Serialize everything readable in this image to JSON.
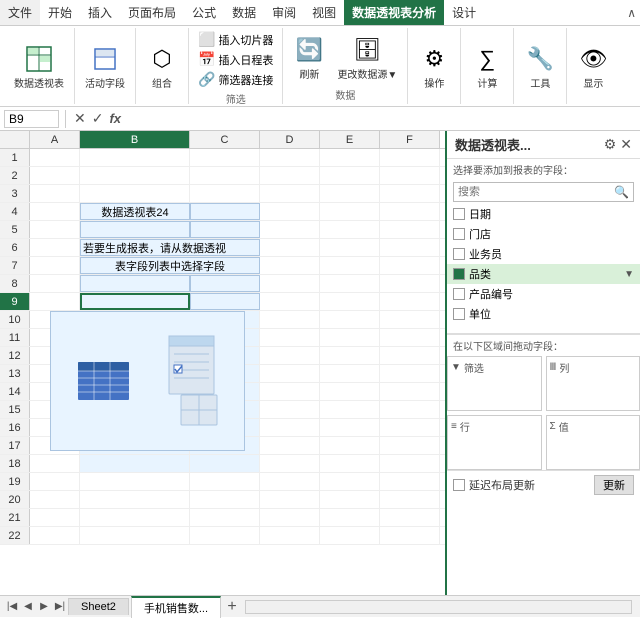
{
  "ribbon": {
    "tabs": [
      {
        "label": "文件",
        "active": false
      },
      {
        "label": "开始",
        "active": false
      },
      {
        "label": "插入",
        "active": false
      },
      {
        "label": "页面布局",
        "active": false
      },
      {
        "label": "公式",
        "active": false
      },
      {
        "label": "数据",
        "active": false
      },
      {
        "label": "审阅",
        "active": false
      },
      {
        "label": "视图",
        "active": false
      },
      {
        "label": "数据透视表分析",
        "active": true
      },
      {
        "label": "设计",
        "active": false
      }
    ],
    "groups": {
      "pivot": {
        "label": "数据透视表",
        "icon": "📊"
      },
      "active_field": {
        "label": "活动字段",
        "icon": "⬜"
      },
      "group": {
        "label": "组合",
        "icon": "⬡"
      },
      "filter_btns": [
        {
          "label": "插入切片器",
          "icon": "⬜"
        },
        {
          "label": "插入日程表",
          "icon": "📅"
        },
        {
          "label": "筛选器连接",
          "icon": "🔗"
        }
      ],
      "filter_label": "筛选",
      "data_btns": [
        {
          "label": "刷新",
          "icon": "🔄"
        },
        {
          "label": "更改数据源▼",
          "icon": "🗄"
        }
      ],
      "data_label": "数据",
      "actions_label": "操作",
      "actions_icon": "⚙",
      "calc_label": "计算",
      "calc_icon": "∑",
      "tools_label": "工具",
      "tools_icon": "🔧",
      "show_label": "显示",
      "show_icon": "👁"
    }
  },
  "formula_bar": {
    "cell_ref": "B9",
    "func_icon": "fx"
  },
  "columns": [
    "A",
    "B",
    "C",
    "D",
    "E",
    "F"
  ],
  "rows": [
    1,
    2,
    3,
    4,
    5,
    6,
    7,
    8,
    9,
    10,
    11,
    12,
    13,
    14,
    15,
    16,
    17,
    18,
    19,
    20,
    21,
    22
  ],
  "active_cell": {
    "row": 9,
    "col": "B"
  },
  "pivot_placeholder": {
    "title": "数据透视表24",
    "desc": "若要生成报表，请从数据透视\n表字段列表中选择字段"
  },
  "panel": {
    "title": "数据透视表...",
    "search_placeholder": "搜索",
    "fields_label": "选择要添加到报表的字段：",
    "fields": [
      {
        "label": "日期",
        "checked": false
      },
      {
        "label": "门店",
        "checked": false
      },
      {
        "label": "业务员",
        "checked": false
      },
      {
        "label": "品类",
        "checked": true,
        "dropdown": true
      },
      {
        "label": "产品编号",
        "checked": false
      },
      {
        "label": "单位",
        "checked": false
      }
    ],
    "drag_label": "在以下区域间拖动字段：",
    "drag_areas": [
      {
        "icon": "▼",
        "label": "筛选"
      },
      {
        "icon": "Ⅲ",
        "label": "列"
      },
      {
        "icon": "≡",
        "label": "行"
      },
      {
        "icon": "Σ",
        "label": "值"
      }
    ],
    "delay_label": "延迟布局更新",
    "update_label": "更新"
  },
  "sheet_tabs": [
    {
      "label": "Sheet2",
      "active": false
    },
    {
      "label": "手机销售数...",
      "active": true
    }
  ]
}
